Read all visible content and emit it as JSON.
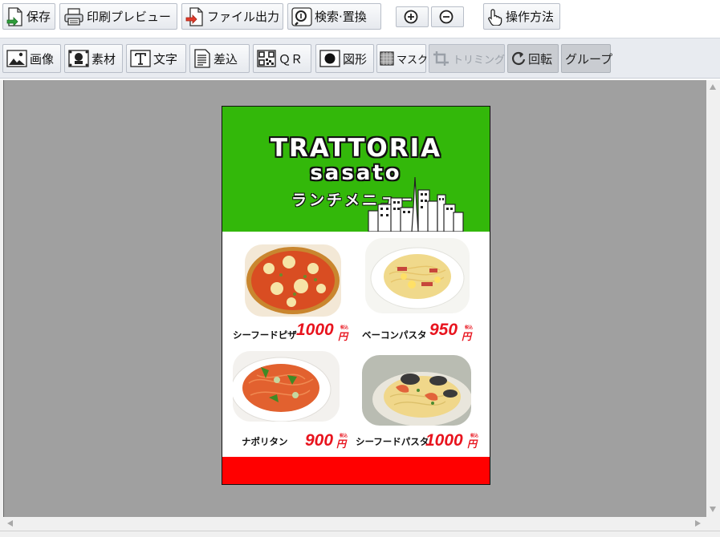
{
  "toolbar_top": {
    "save": "保存",
    "print_preview": "印刷プレビュー",
    "file_output": "ファイル出力",
    "search_replace": "検索·置換",
    "zoom_in": "",
    "zoom_out": "",
    "how_to": "操作方法"
  },
  "toolbar_insert": {
    "image": "画像",
    "material": "素材",
    "text": "文字",
    "merge": "差込",
    "qr": "ＱＲ",
    "shape": "図形",
    "mask": "マスク",
    "trimming": "トリミング",
    "rotate": "回転",
    "group": "グループ"
  },
  "poster": {
    "title": "TRATTORIA",
    "subtitle": "sasato",
    "tagline": "ランチメニュー",
    "items": [
      {
        "name": "シーフードピザ",
        "price": "1000",
        "yen": "円",
        "tax": "税込"
      },
      {
        "name": "ベーコンパスタ",
        "price": "950",
        "yen": "円",
        "tax": "税込"
      },
      {
        "name": "ナポリタン",
        "price": "900",
        "yen": "円",
        "tax": "税込"
      },
      {
        "name": "シーフードパスタ",
        "price": "1000",
        "yen": "円",
        "tax": "税込"
      }
    ]
  },
  "colors": {
    "header_green": "#33b80a",
    "footer_red": "#ff0000",
    "price_red": "#e8141e",
    "canvas_grey": "#a0a0a0"
  }
}
